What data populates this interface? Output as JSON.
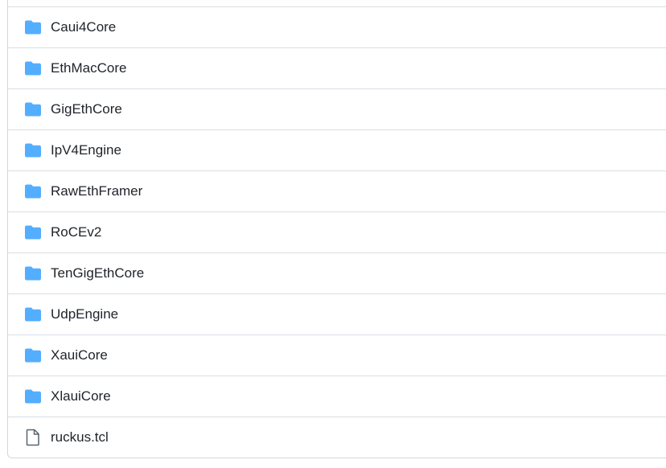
{
  "colors": {
    "folder": "#54aeff",
    "file": "#59636e",
    "text": "#1f2328",
    "border": "#d0d7de"
  },
  "items": [
    {
      "name": "Caui4Core",
      "type": "folder",
      "icon": "folder-icon"
    },
    {
      "name": "EthMacCore",
      "type": "folder",
      "icon": "folder-icon"
    },
    {
      "name": "GigEthCore",
      "type": "folder",
      "icon": "folder-icon"
    },
    {
      "name": "IpV4Engine",
      "type": "folder",
      "icon": "folder-icon"
    },
    {
      "name": "RawEthFramer",
      "type": "folder",
      "icon": "folder-icon"
    },
    {
      "name": "RoCEv2",
      "type": "folder",
      "icon": "folder-icon"
    },
    {
      "name": "TenGigEthCore",
      "type": "folder",
      "icon": "folder-icon"
    },
    {
      "name": "UdpEngine",
      "type": "folder",
      "icon": "folder-icon"
    },
    {
      "name": "XauiCore",
      "type": "folder",
      "icon": "folder-icon"
    },
    {
      "name": "XlauiCore",
      "type": "folder",
      "icon": "folder-icon"
    },
    {
      "name": "ruckus.tcl",
      "type": "file",
      "icon": "file-icon"
    }
  ]
}
